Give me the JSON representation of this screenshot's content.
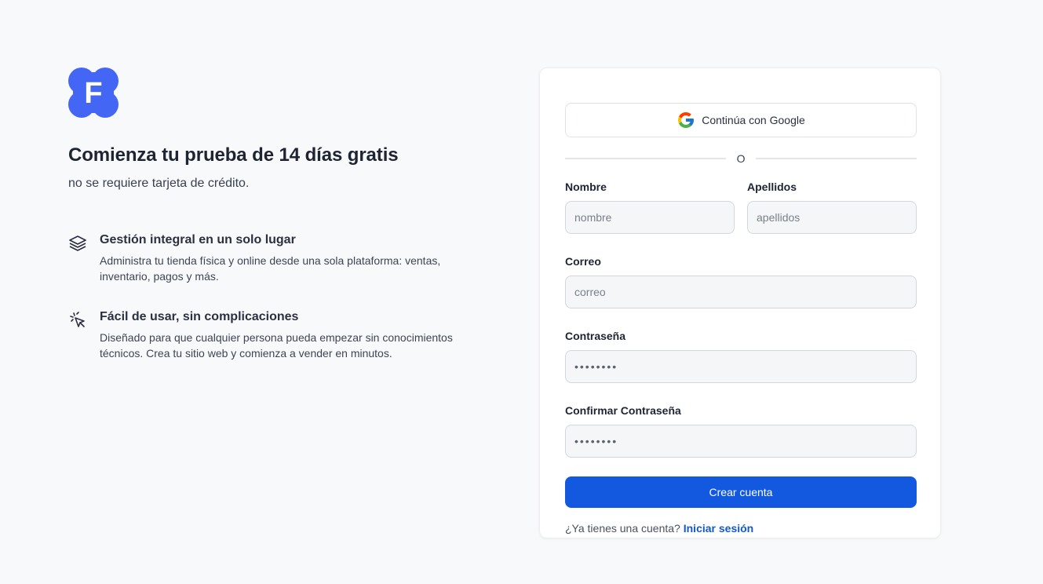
{
  "brand": {
    "logo_letter": "F",
    "logo_color": "#4466f5"
  },
  "hero": {
    "title": "Comienza tu prueba de 14 días gratis",
    "subtitle": "no se requiere tarjeta de crédito."
  },
  "features": [
    {
      "icon": "layers-icon",
      "title": "Gestión integral en un solo lugar",
      "description": "Administra tu tienda física y online desde una sola plataforma: ventas, inventario, pagos y más."
    },
    {
      "icon": "cursor-click-icon",
      "title": "Fácil de usar, sin complicaciones",
      "description": "Diseñado para que cualquier persona pueda empezar sin conocimientos técnicos. Crea tu sitio web y comienza a vender en minutos."
    }
  ],
  "form": {
    "google_label": "Continúa con Google",
    "divider": "O",
    "first_name": {
      "label": "Nombre",
      "placeholder": "nombre"
    },
    "last_name": {
      "label": "Apellidos",
      "placeholder": "apellidos"
    },
    "email": {
      "label": "Correo",
      "placeholder": "correo"
    },
    "password": {
      "label": "Contraseña",
      "placeholder": "••••••••"
    },
    "confirm_password": {
      "label": "Confirmar Contraseña",
      "placeholder": "••••••••"
    },
    "submit_label": "Crear cuenta",
    "signin_prompt": "¿Ya tienes una cuenta?",
    "signin_link": "Iniciar sesión"
  },
  "colors": {
    "primary": "#1259e0",
    "link": "#1259c8",
    "background": "#f8f9fb"
  }
}
